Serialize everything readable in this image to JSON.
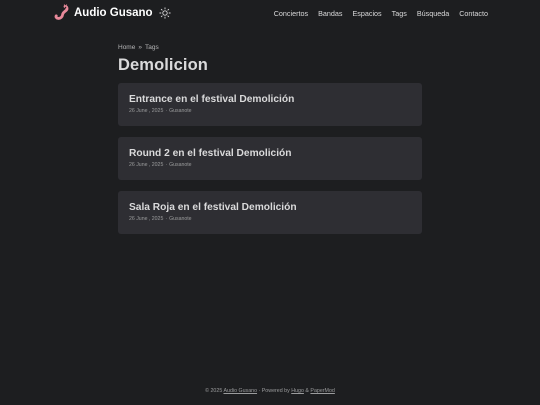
{
  "site": {
    "title": "Audio Gusano",
    "logo_icon": "worm-icon",
    "theme_icon": "sun-icon"
  },
  "nav": {
    "items": [
      "Conciertos",
      "Bandas",
      "Espacios",
      "Tags",
      "Búsqueda",
      "Contacto"
    ]
  },
  "breadcrumb": {
    "home": "Home",
    "separator": "»",
    "tags": "Tags"
  },
  "page": {
    "title": "Demolicion"
  },
  "posts": [
    {
      "title": "Entrance en el festival Demolición",
      "date": "26 June , 2025",
      "sep": "·",
      "author": "Gusanote"
    },
    {
      "title": "Round 2 en el festival Demolición",
      "date": "26 June , 2025",
      "sep": "·",
      "author": "Gusanote"
    },
    {
      "title": "Sala Roja en el festival Demolición",
      "date": "26 June , 2025",
      "sep": "·",
      "author": "Gusanote"
    }
  ],
  "footer": {
    "prefix": "© 2025",
    "site_link": "Audio Gusano",
    "middle": "· Powered by",
    "hugo": "Hugo",
    "amp": "&",
    "papermod": "PaperMod"
  },
  "colors": {
    "background": "#1d1e20",
    "card": "#2e2e33",
    "text": "#dadadb",
    "worm_pink": "#e8899a"
  }
}
